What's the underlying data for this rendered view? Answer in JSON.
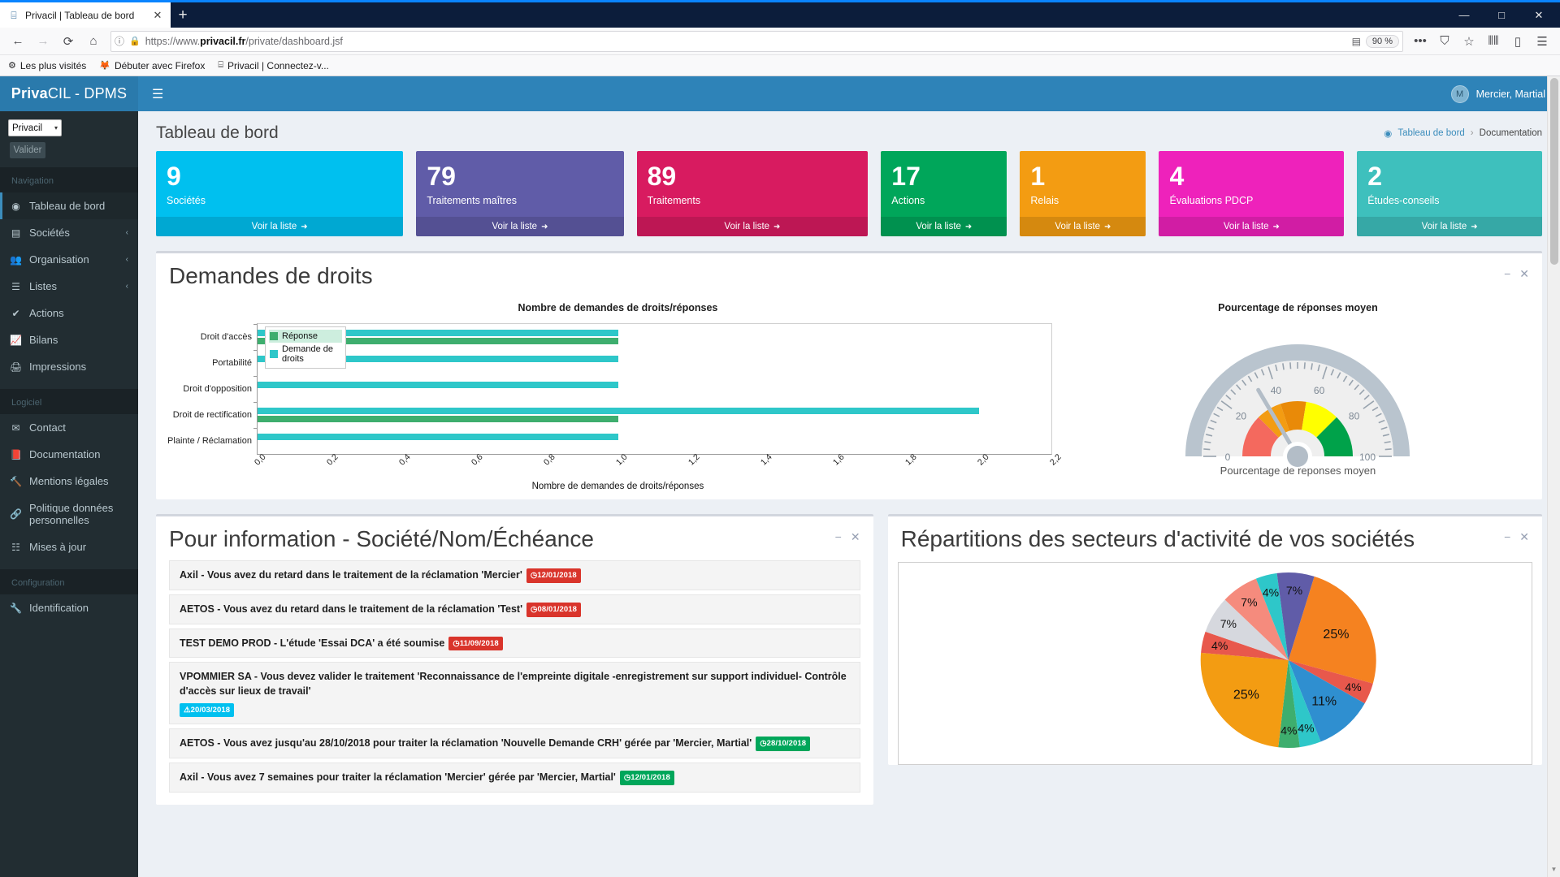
{
  "browser": {
    "tab": {
      "title": "Privacil | Tableau de bord",
      "favicon": "privacil-favicon",
      "close": "✕"
    },
    "newtab_label": "+",
    "window_controls": {
      "minimize": "—",
      "maximize": "□",
      "close": "✕"
    },
    "nav": {
      "back": "←",
      "forward": "→",
      "reload": "⟳",
      "home": "⌂"
    },
    "url": {
      "info_icon": "ⓘ",
      "lock_icon": "🔒",
      "protocol": "https://www.",
      "domain": "privacil.fr",
      "path": "/private/dashboard.jsf"
    },
    "reader_icon": "▤",
    "zoom": "90 %",
    "menu_icons": {
      "more": "•••",
      "pocket": "⛉",
      "bookmark_star": "☆",
      "library": "⦀⦀",
      "sidebar": "▯",
      "app_menu": "☰"
    },
    "bookmarks": [
      {
        "icon": "⚙",
        "label": "Les plus visités"
      },
      {
        "icon": "🦊",
        "label": "Débuter avec Firefox"
      },
      {
        "icon": "⌸",
        "label": "Privacil | Connectez-v..."
      }
    ]
  },
  "app": {
    "brand_bold": "Priva",
    "brand_light": "CIL - DPMS",
    "hamburger": "☰",
    "user_name": "Mercier, Martial",
    "avatar_initials": "M"
  },
  "sidebar": {
    "company_select": {
      "value": "Privacil",
      "caret": "▾"
    },
    "validate_button": "Valider",
    "sections": [
      {
        "header": "Navigation",
        "items": [
          {
            "icon": "dashboard-icon",
            "glyph": "◉",
            "label": "Tableau de bord",
            "chevron": "",
            "active": true
          },
          {
            "icon": "building-icon",
            "glyph": "▤",
            "label": "Sociétés",
            "chevron": "‹"
          },
          {
            "icon": "users-icon",
            "glyph": "👥",
            "label": "Organisation",
            "chevron": "‹"
          },
          {
            "icon": "list-icon",
            "glyph": "☰",
            "label": "Listes",
            "chevron": "‹"
          },
          {
            "icon": "check-icon",
            "glyph": "✔",
            "label": "Actions",
            "chevron": ""
          },
          {
            "icon": "chart-line-icon",
            "glyph": "📈",
            "label": "Bilans",
            "chevron": ""
          },
          {
            "icon": "printer-icon",
            "glyph": "🖨",
            "label": "Impressions",
            "chevron": ""
          }
        ]
      },
      {
        "header": "Logiciel",
        "items": [
          {
            "icon": "envelope-icon",
            "glyph": "✉",
            "label": "Contact",
            "chevron": ""
          },
          {
            "icon": "book-icon",
            "glyph": "📕",
            "label": "Documentation",
            "chevron": ""
          },
          {
            "icon": "gavel-icon",
            "glyph": "🔨",
            "label": "Mentions légales",
            "chevron": ""
          },
          {
            "icon": "link-icon",
            "glyph": "🔗",
            "label": "Politique données personnelles",
            "chevron": ""
          },
          {
            "icon": "tasks-icon",
            "glyph": "☷",
            "label": "Mises à jour",
            "chevron": ""
          }
        ]
      },
      {
        "header": "Configuration",
        "items": [
          {
            "icon": "wrench-icon",
            "glyph": "🔧",
            "label": "Identification",
            "chevron": ""
          }
        ]
      }
    ]
  },
  "page": {
    "title": "Tableau de bord",
    "breadcrumb": {
      "home_icon": "dashboard-icon",
      "home": "Tableau de bord",
      "sep": "›",
      "current": "Documentation"
    }
  },
  "kpis": [
    {
      "value": "9",
      "label": "Sociétés",
      "link": "Voir la liste",
      "arrow": "➜",
      "color": "#00c0ef"
    },
    {
      "value": "79",
      "label": "Traitements maîtres",
      "link": "Voir la liste",
      "arrow": "➜",
      "color": "#605ca8"
    },
    {
      "value": "89",
      "label": "Traitements",
      "link": "Voir la liste",
      "arrow": "➜",
      "color": "#d81b60"
    },
    {
      "value": "17",
      "label": "Actions",
      "link": "Voir la liste",
      "arrow": "➜",
      "color": "#00a65a"
    },
    {
      "value": "1",
      "label": "Relais",
      "link": "Voir la liste",
      "arrow": "➜",
      "color": "#f39c12"
    },
    {
      "value": "4",
      "label": "Évaluations PDCP",
      "link": "Voir la liste",
      "arrow": "➜",
      "color": "#ee22bb"
    },
    {
      "value": "2",
      "label": "Études-conseils",
      "link": "Voir la liste",
      "arrow": "➜",
      "color": "#3ec0bd"
    }
  ],
  "rights_card": {
    "title": "Demandes de droits",
    "collapse_icon": "−",
    "close_icon": "✕"
  },
  "info_card": {
    "title": "Pour information - Société/Nom/Échéance",
    "collapse_icon": "−",
    "close_icon": "✕",
    "items": [
      {
        "text": "Axil - Vous avez du retard dans le traitement de la réclamation 'Mercier'",
        "badge": "12/01/2018",
        "badge_icon": "◷",
        "badge_color": "red",
        "badge_block": false
      },
      {
        "text": "AETOS - Vous avez du retard dans le traitement de la réclamation 'Test'",
        "badge": "08/01/2018",
        "badge_icon": "◷",
        "badge_color": "red",
        "badge_block": false
      },
      {
        "text": "TEST DEMO PROD - L'étude 'Essai DCA' a été soumise",
        "badge": "11/09/2018",
        "badge_icon": "◷",
        "badge_color": "red",
        "badge_block": false
      },
      {
        "text": "VPOMMIER SA - Vous devez valider le traitement 'Reconnaissance de l'empreinte digitale -enregistrement sur support individuel- Contrôle d'accès sur lieux de travail'",
        "badge": "20/03/2018",
        "badge_icon": "⚠",
        "badge_color": "blue",
        "badge_block": true
      },
      {
        "text": "AETOS - Vous avez jusqu'au 28/10/2018 pour traiter la réclamation 'Nouvelle Demande CRH' gérée par 'Mercier, Martial'",
        "badge": "28/10/2018",
        "badge_icon": "◷",
        "badge_color": "green",
        "badge_block": false
      },
      {
        "text": "Axil - Vous avez 7 semaines pour traiter la réclamation 'Mercier' gérée par 'Mercier, Martial'",
        "badge": "12/01/2018",
        "badge_icon": "◷",
        "badge_color": "green",
        "badge_block": false
      }
    ]
  },
  "pie_card": {
    "title": "Répartitions des secteurs d'activité de vos sociétés",
    "collapse_icon": "−",
    "close_icon": "✕"
  },
  "chart_data": [
    {
      "type": "bar",
      "orientation": "horizontal",
      "title": "Nombre de demandes de droits/réponses",
      "xlabel": "Nombre de demandes de droits/réponses",
      "ylabel": "",
      "xlim": [
        0.0,
        2.2
      ],
      "xticks": [
        "0,0",
        "0,2",
        "0,4",
        "0,6",
        "0,8",
        "1,0",
        "1,2",
        "1,4",
        "1,6",
        "1,8",
        "2,0",
        "2,2"
      ],
      "categories": [
        "Droit d'accès",
        "Portabilité",
        "Droit d'opposition",
        "Droit de rectification",
        "Plainte / Réclamation"
      ],
      "legend": [
        "Réponse",
        "Demande de droits"
      ],
      "legend_position": "inside-left",
      "legend_colors": [
        "#3eae6e",
        "#2ec7c9"
      ],
      "grid": false,
      "series": [
        {
          "name": "Demande de droits",
          "color": "#2ec7c9",
          "values": [
            1.0,
            1.0,
            1.0,
            2.0,
            1.0
          ]
        },
        {
          "name": "Réponse",
          "color": "#3eae6e",
          "values": [
            1.0,
            0.0,
            0.0,
            1.0,
            0.0
          ]
        }
      ]
    },
    {
      "type": "gauge",
      "title": "Pourcentage de réponses moyen",
      "caption": "Pourcentage de réponses moyen",
      "min": 0,
      "max": 100,
      "value": 33,
      "ticks": [
        0,
        20,
        40,
        60,
        80,
        100
      ],
      "bands": [
        {
          "from": 0,
          "to": 25,
          "color": "#f4695e"
        },
        {
          "from": 25,
          "to": 40,
          "color": "#f39c12"
        },
        {
          "from": 40,
          "to": 55,
          "color": "#e98a08"
        },
        {
          "from": 55,
          "to": 75,
          "color": "#ffff00"
        },
        {
          "from": 75,
          "to": 100,
          "color": "#00a24a"
        }
      ]
    },
    {
      "type": "pie",
      "title": "Répartitions des secteurs d'activité de vos sociétés",
      "labels_shown": [
        "25%",
        "4%",
        "11%",
        "4%",
        "4%",
        "25%",
        "4%",
        "7%",
        "7%",
        "4%",
        "7%"
      ],
      "values": [
        25,
        4,
        11,
        4,
        4,
        25,
        4,
        7,
        7,
        4,
        7
      ],
      "colors": [
        "#f58220",
        "#e8584c",
        "#2f8fd0",
        "#2ec7c9",
        "#3eae6e",
        "#f39c12",
        "#e8584c",
        "#d6d8de",
        "#f58b7d",
        "#2ec7c9",
        "#605ca8"
      ]
    }
  ]
}
